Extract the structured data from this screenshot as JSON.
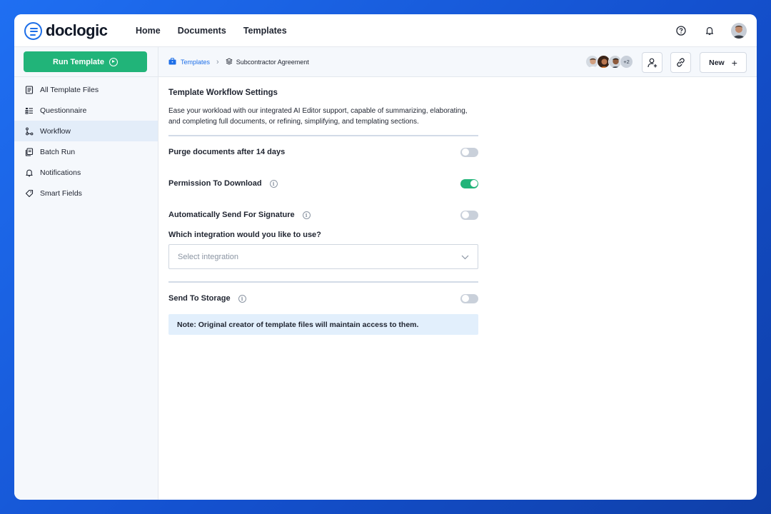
{
  "app": {
    "logo_text": "doclogic"
  },
  "nav": {
    "items": [
      "Home",
      "Documents",
      "Templates"
    ]
  },
  "top_icons": [
    "help-icon",
    "bell-icon",
    "user-avatar"
  ],
  "sidebar": {
    "run_button": "Run Template",
    "items": [
      {
        "label": "All Template Files",
        "icon": "document-list-icon"
      },
      {
        "label": "Questionnaire",
        "icon": "list-icon"
      },
      {
        "label": "Workflow",
        "icon": "workflow-icon",
        "active": true
      },
      {
        "label": "Batch Run",
        "icon": "files-icon"
      },
      {
        "label": "Notifications",
        "icon": "bell-icon"
      },
      {
        "label": "Smart Fields",
        "icon": "tag-icon"
      }
    ]
  },
  "breadcrumb": {
    "parent": "Templates",
    "current": "Subcontractor Agreement"
  },
  "collaborators": {
    "more": "+2"
  },
  "toolbar": {
    "new_label": "New"
  },
  "settings": {
    "title": "Template Workflow Settings",
    "description": "Ease your workload with our integrated AI Editor support, capable of  summarizing, elaborating, and completing full documents, or refining,  simplifying, and templating sections.",
    "purge": {
      "label": "Purge documents after 14 days",
      "enabled": false
    },
    "download": {
      "label": "Permission To Download",
      "enabled": true
    },
    "signature": {
      "label": "Automatically Send For Signature",
      "enabled": false
    },
    "integration": {
      "question": "Which integration would you like to use?",
      "placeholder": "Select integration"
    },
    "storage": {
      "label": "Send To Storage",
      "enabled": false
    },
    "note": "Note: Original creator of template files will maintain access to them."
  },
  "colors": {
    "accent_green": "#21b479",
    "accent_blue": "#1e6fe8",
    "note_bg": "#e2effc"
  }
}
